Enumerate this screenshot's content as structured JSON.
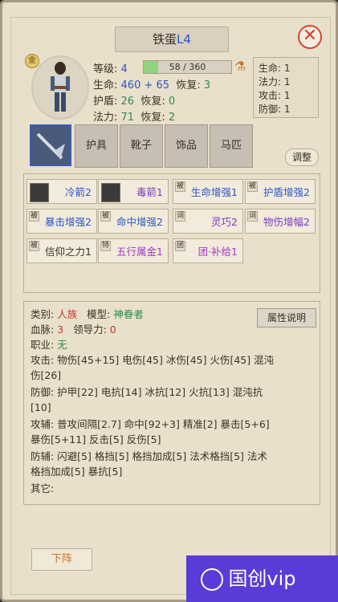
{
  "title": {
    "name": "铁蛋",
    "level_tag": "L4"
  },
  "stats": {
    "level_label": "等级:",
    "level_value": "4",
    "xp_text": "58 / 360",
    "xp_fraction": 0.161,
    "hp_label": "生命:",
    "hp_value": "460 + 65",
    "hp_regen_label": "恢复:",
    "hp_regen_value": "3",
    "shield_label": "护盾:",
    "shield_value": "26",
    "shield_regen_label": "恢复:",
    "shield_regen_value": "0",
    "mp_label": "法力:",
    "mp_value": "71",
    "mp_regen_label": "恢复:",
    "mp_regen_value": "2"
  },
  "sidepanel": [
    {
      "label": "生命:",
      "value": "1"
    },
    {
      "label": "法力:",
      "value": "1"
    },
    {
      "label": "攻击:",
      "value": "1"
    },
    {
      "label": "防御:",
      "value": "1"
    }
  ],
  "equip_tabs": [
    "护具",
    "靴子",
    "饰品",
    "马匹"
  ],
  "adjust_label": "调整",
  "skills": [
    {
      "tag": "",
      "label": "冷箭2",
      "color": "#2b56c4",
      "icon": "arrow"
    },
    {
      "tag": "",
      "label": "毒箭1",
      "color": "#7a3bc4",
      "icon": "arrow"
    },
    {
      "tag": "被",
      "label": "生命增强1",
      "color": "#2b56c4"
    },
    {
      "tag": "被",
      "label": "护盾增强2",
      "color": "#2b56c4"
    },
    {
      "tag": "被",
      "label": "暴击增强2",
      "color": "#2b56c4"
    },
    {
      "tag": "被",
      "label": "命中增强2",
      "color": "#2b56c4"
    },
    {
      "tag": "词",
      "label": "灵巧2",
      "color": "#7a3bc4"
    },
    {
      "tag": "词",
      "label": "物伤增幅2",
      "color": "#7a3bc4"
    },
    {
      "tag": "被",
      "label": "信仰之力1",
      "color": "#3a3126"
    },
    {
      "tag": "特",
      "label": "五行属金1",
      "color": "#a436c4"
    },
    {
      "tag": "团",
      "label": "团·补给1",
      "color": "#a436c4"
    }
  ],
  "info": {
    "attr_button": "属性说明",
    "class_label": "类别:",
    "class_value": "人族",
    "model_label": "模型:",
    "model_value": "神眷者",
    "blood_label": "血脉:",
    "blood_value": "3",
    "lead_label": "领导力:",
    "lead_value": "0",
    "job_label": "职业:",
    "job_value": "无",
    "attack_line1": "攻击: 物伤[45+15] 电伤[45] 冰伤[45] 火伤[45] 混沌",
    "attack_line2": "伤[26]",
    "defense_line1": "防御: 护甲[22] 电抗[14] 冰抗[12] 火抗[13] 混沌抗",
    "defense_line2": "[10]",
    "assist_line1": "攻辅: 普攻间隔[2.7] 命中[92+3] 精准[2] 暴击[5+6]",
    "assist_line2": "暴伤[5+11] 反击[5] 反伤[5]",
    "defassist_line1": "防辅: 闪避[5] 格挡[5] 格挡加成[5] 法术格挡[5] 法术",
    "defassist_line2": "格挡加成[5] 暴抗[5]",
    "other_label": "其它:"
  },
  "bottom_button": "下阵",
  "watermark": "国创vip"
}
